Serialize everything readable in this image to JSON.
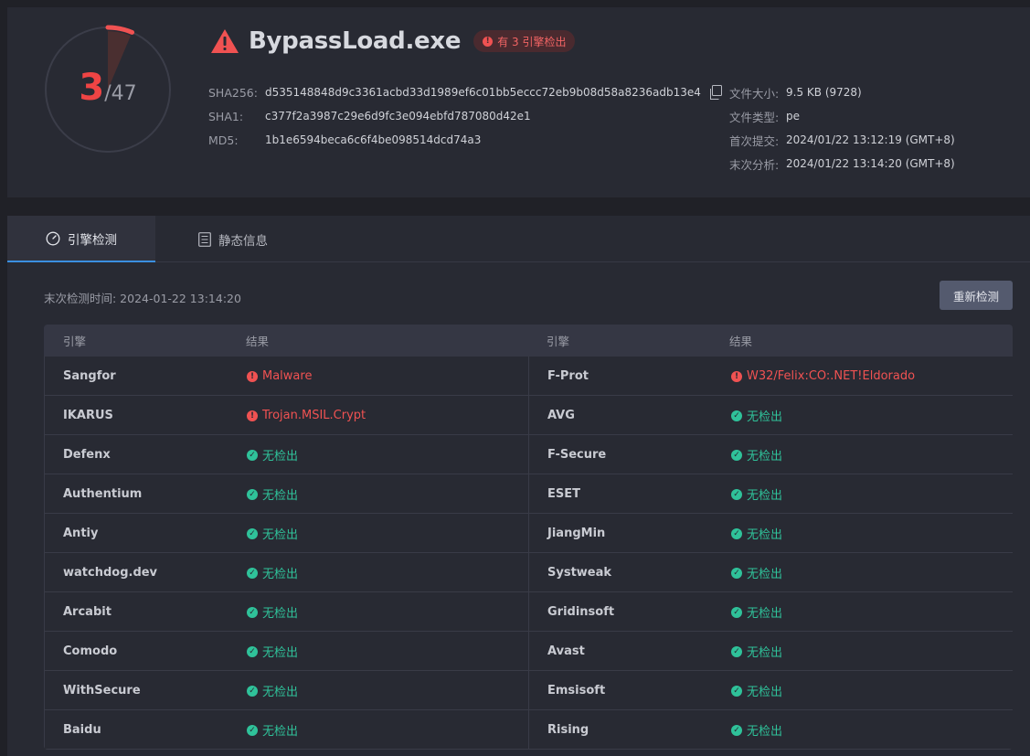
{
  "summary": {
    "detections": "3",
    "total": "/47",
    "detection_ratio": 0.0638,
    "file_name": "BypassLoad.exe",
    "badge": "有 3 引擎检出",
    "hashes": [
      {
        "label": "SHA256:",
        "value": "d535148848d9c3361acbd33d1989ef6c01bb5eccc72eb9b08d58a8236adb13e4"
      },
      {
        "label": "SHA1:",
        "value": "c377f2a3987c29e6d9fc3e094ebfd787080d42e1"
      },
      {
        "label": "MD5:",
        "value": "1b1e6594beca6c6f4be098514dcd74a3"
      }
    ],
    "meta": [
      {
        "label": "文件大小:",
        "value": "9.5 KB (9728)"
      },
      {
        "label": "文件类型:",
        "value": "pe"
      },
      {
        "label": "首次提交:",
        "value": "2024/01/22 13:12:19 (GMT+8)"
      },
      {
        "label": "末次分析:",
        "value": "2024/01/22 13:14:20 (GMT+8)"
      }
    ]
  },
  "tabs": {
    "engine_detection": "引擎检测",
    "static_info": "静态信息"
  },
  "scan": {
    "last_scan": "末次检测时间: 2024-01-22 13:14:20",
    "rescan_label": "重新检测"
  },
  "table": {
    "headers": {
      "engine_left": "引擎",
      "result_left": "结果",
      "engine_right": "引擎",
      "result_right": "结果"
    },
    "rows": [
      {
        "left": {
          "engine": "Sangfor",
          "result": "Malware",
          "status": "bad"
        },
        "right": {
          "engine": "F-Prot",
          "result": "W32/Felix:CO:.NET!Eldorado",
          "status": "bad"
        }
      },
      {
        "left": {
          "engine": "IKARUS",
          "result": "Trojan.MSIL.Crypt",
          "status": "bad"
        },
        "right": {
          "engine": "AVG",
          "result": "无检出",
          "status": "ok"
        }
      },
      {
        "left": {
          "engine": "Defenx",
          "result": "无检出",
          "status": "ok"
        },
        "right": {
          "engine": "F-Secure",
          "result": "无检出",
          "status": "ok"
        }
      },
      {
        "left": {
          "engine": "Authentium",
          "result": "无检出",
          "status": "ok"
        },
        "right": {
          "engine": "ESET",
          "result": "无检出",
          "status": "ok"
        }
      },
      {
        "left": {
          "engine": "Antiy",
          "result": "无检出",
          "status": "ok"
        },
        "right": {
          "engine": "JiangMin",
          "result": "无检出",
          "status": "ok"
        }
      },
      {
        "left": {
          "engine": "watchdog.dev",
          "result": "无检出",
          "status": "ok"
        },
        "right": {
          "engine": "Systweak",
          "result": "无检出",
          "status": "ok"
        }
      },
      {
        "left": {
          "engine": "Arcabit",
          "result": "无检出",
          "status": "ok"
        },
        "right": {
          "engine": "Gridinsoft",
          "result": "无检出",
          "status": "ok"
        }
      },
      {
        "left": {
          "engine": "Comodo",
          "result": "无检出",
          "status": "ok"
        },
        "right": {
          "engine": "Avast",
          "result": "无检出",
          "status": "ok"
        }
      },
      {
        "left": {
          "engine": "WithSecure",
          "result": "无检出",
          "status": "ok"
        },
        "right": {
          "engine": "Emsisoft",
          "result": "无检出",
          "status": "ok"
        }
      },
      {
        "left": {
          "engine": "Baidu",
          "result": "无检出",
          "status": "ok"
        },
        "right": {
          "engine": "Rising",
          "result": "无检出",
          "status": "ok"
        }
      }
    ]
  },
  "colors": {
    "danger": "#f05252",
    "safe": "#2fc29a",
    "accent": "#3b8fe0"
  },
  "icons": {
    "warning": "warning-triangle-icon",
    "copy": "copy-icon",
    "gauge_tab": "gauge-icon",
    "document_tab": "document-icon",
    "alert": "alert-circle-icon",
    "check": "check-circle-icon"
  }
}
